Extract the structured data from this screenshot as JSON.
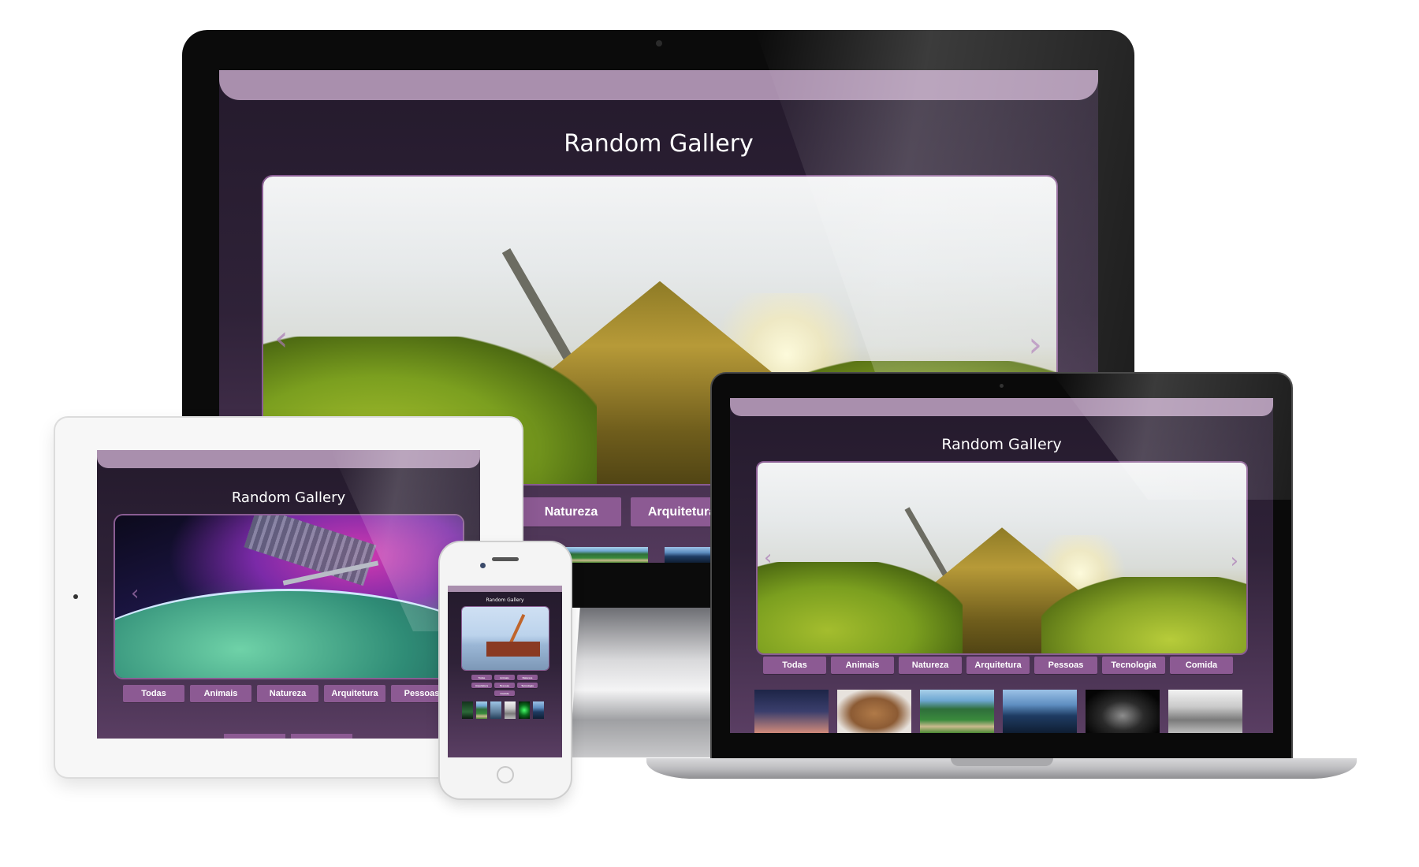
{
  "gallery": {
    "title": "Random Gallery",
    "filters": [
      "Todas",
      "Animais",
      "Natureza",
      "Arquitetura",
      "Pessoas",
      "Tecnologia",
      "Comida"
    ]
  },
  "devices": [
    "iMac",
    "iPad",
    "MacBook Pro",
    "iPhone"
  ],
  "photos": {
    "desktop_featured": "canoe in sunlit grass by a lake",
    "tablet_featured": "aurora over earth seen from space station",
    "phone_featured": "rusted ship with crane on icy water"
  },
  "colors": {
    "accent": "#8c5a93",
    "topbar": "#a98fad",
    "screen_bg": "#2f2238"
  },
  "icons": {
    "prev": "‹",
    "next": "›"
  }
}
